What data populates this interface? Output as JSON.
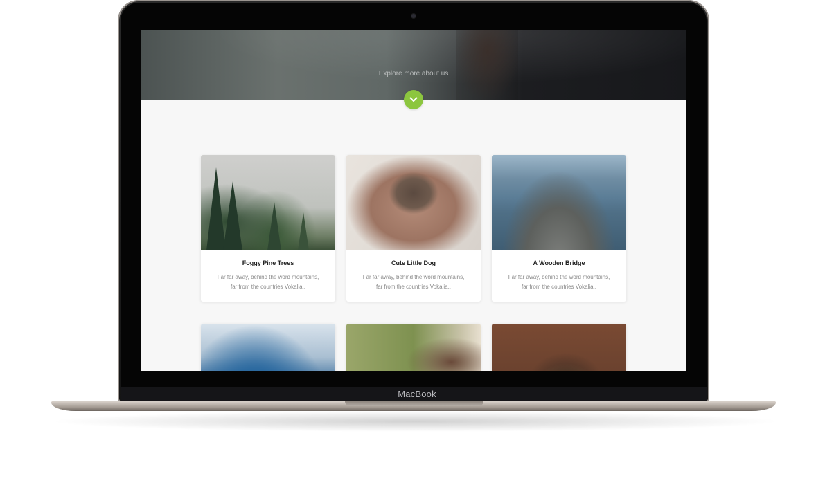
{
  "device": {
    "brand": "MacBook"
  },
  "hero": {
    "text": "Explore more about us"
  },
  "cards": [
    {
      "title": "Foggy Pine Trees",
      "desc_line1": "Far far away, behind the word mountains,",
      "desc_line2": "far from the countries Vokalia.."
    },
    {
      "title": "Cute Little Dog",
      "desc_line1": "Far far away, behind the word mountains,",
      "desc_line2": "far from the countries Vokalia.."
    },
    {
      "title": "A Wooden Bridge",
      "desc_line1": "Far far away, behind the word mountains,",
      "desc_line2": "far from the countries Vokalia.."
    }
  ],
  "colors": {
    "accent": "#8cc63f",
    "background": "#f7f7f7"
  },
  "icons": {
    "scroll_down": "chevron-down-icon"
  }
}
